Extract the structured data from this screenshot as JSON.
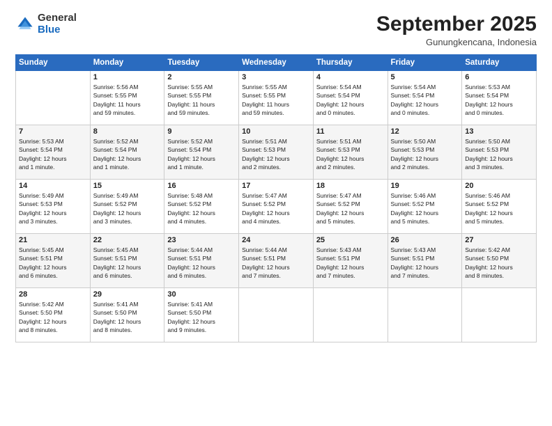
{
  "logo": {
    "general": "General",
    "blue": "Blue"
  },
  "header": {
    "month": "September 2025",
    "location": "Gunungkencana, Indonesia"
  },
  "days_header": [
    "Sunday",
    "Monday",
    "Tuesday",
    "Wednesday",
    "Thursday",
    "Friday",
    "Saturday"
  ],
  "weeks": [
    [
      {
        "day": "",
        "info": ""
      },
      {
        "day": "1",
        "info": "Sunrise: 5:56 AM\nSunset: 5:55 PM\nDaylight: 11 hours\nand 59 minutes."
      },
      {
        "day": "2",
        "info": "Sunrise: 5:55 AM\nSunset: 5:55 PM\nDaylight: 11 hours\nand 59 minutes."
      },
      {
        "day": "3",
        "info": "Sunrise: 5:55 AM\nSunset: 5:55 PM\nDaylight: 11 hours\nand 59 minutes."
      },
      {
        "day": "4",
        "info": "Sunrise: 5:54 AM\nSunset: 5:54 PM\nDaylight: 12 hours\nand 0 minutes."
      },
      {
        "day": "5",
        "info": "Sunrise: 5:54 AM\nSunset: 5:54 PM\nDaylight: 12 hours\nand 0 minutes."
      },
      {
        "day": "6",
        "info": "Sunrise: 5:53 AM\nSunset: 5:54 PM\nDaylight: 12 hours\nand 0 minutes."
      }
    ],
    [
      {
        "day": "7",
        "info": "Sunrise: 5:53 AM\nSunset: 5:54 PM\nDaylight: 12 hours\nand 1 minute."
      },
      {
        "day": "8",
        "info": "Sunrise: 5:52 AM\nSunset: 5:54 PM\nDaylight: 12 hours\nand 1 minute."
      },
      {
        "day": "9",
        "info": "Sunrise: 5:52 AM\nSunset: 5:54 PM\nDaylight: 12 hours\nand 1 minute."
      },
      {
        "day": "10",
        "info": "Sunrise: 5:51 AM\nSunset: 5:53 PM\nDaylight: 12 hours\nand 2 minutes."
      },
      {
        "day": "11",
        "info": "Sunrise: 5:51 AM\nSunset: 5:53 PM\nDaylight: 12 hours\nand 2 minutes."
      },
      {
        "day": "12",
        "info": "Sunrise: 5:50 AM\nSunset: 5:53 PM\nDaylight: 12 hours\nand 2 minutes."
      },
      {
        "day": "13",
        "info": "Sunrise: 5:50 AM\nSunset: 5:53 PM\nDaylight: 12 hours\nand 3 minutes."
      }
    ],
    [
      {
        "day": "14",
        "info": "Sunrise: 5:49 AM\nSunset: 5:53 PM\nDaylight: 12 hours\nand 3 minutes."
      },
      {
        "day": "15",
        "info": "Sunrise: 5:49 AM\nSunset: 5:52 PM\nDaylight: 12 hours\nand 3 minutes."
      },
      {
        "day": "16",
        "info": "Sunrise: 5:48 AM\nSunset: 5:52 PM\nDaylight: 12 hours\nand 4 minutes."
      },
      {
        "day": "17",
        "info": "Sunrise: 5:47 AM\nSunset: 5:52 PM\nDaylight: 12 hours\nand 4 minutes."
      },
      {
        "day": "18",
        "info": "Sunrise: 5:47 AM\nSunset: 5:52 PM\nDaylight: 12 hours\nand 5 minutes."
      },
      {
        "day": "19",
        "info": "Sunrise: 5:46 AM\nSunset: 5:52 PM\nDaylight: 12 hours\nand 5 minutes."
      },
      {
        "day": "20",
        "info": "Sunrise: 5:46 AM\nSunset: 5:52 PM\nDaylight: 12 hours\nand 5 minutes."
      }
    ],
    [
      {
        "day": "21",
        "info": "Sunrise: 5:45 AM\nSunset: 5:51 PM\nDaylight: 12 hours\nand 6 minutes."
      },
      {
        "day": "22",
        "info": "Sunrise: 5:45 AM\nSunset: 5:51 PM\nDaylight: 12 hours\nand 6 minutes."
      },
      {
        "day": "23",
        "info": "Sunrise: 5:44 AM\nSunset: 5:51 PM\nDaylight: 12 hours\nand 6 minutes."
      },
      {
        "day": "24",
        "info": "Sunrise: 5:44 AM\nSunset: 5:51 PM\nDaylight: 12 hours\nand 7 minutes."
      },
      {
        "day": "25",
        "info": "Sunrise: 5:43 AM\nSunset: 5:51 PM\nDaylight: 12 hours\nand 7 minutes."
      },
      {
        "day": "26",
        "info": "Sunrise: 5:43 AM\nSunset: 5:51 PM\nDaylight: 12 hours\nand 7 minutes."
      },
      {
        "day": "27",
        "info": "Sunrise: 5:42 AM\nSunset: 5:50 PM\nDaylight: 12 hours\nand 8 minutes."
      }
    ],
    [
      {
        "day": "28",
        "info": "Sunrise: 5:42 AM\nSunset: 5:50 PM\nDaylight: 12 hours\nand 8 minutes."
      },
      {
        "day": "29",
        "info": "Sunrise: 5:41 AM\nSunset: 5:50 PM\nDaylight: 12 hours\nand 8 minutes."
      },
      {
        "day": "30",
        "info": "Sunrise: 5:41 AM\nSunset: 5:50 PM\nDaylight: 12 hours\nand 9 minutes."
      },
      {
        "day": "",
        "info": ""
      },
      {
        "day": "",
        "info": ""
      },
      {
        "day": "",
        "info": ""
      },
      {
        "day": "",
        "info": ""
      }
    ]
  ]
}
